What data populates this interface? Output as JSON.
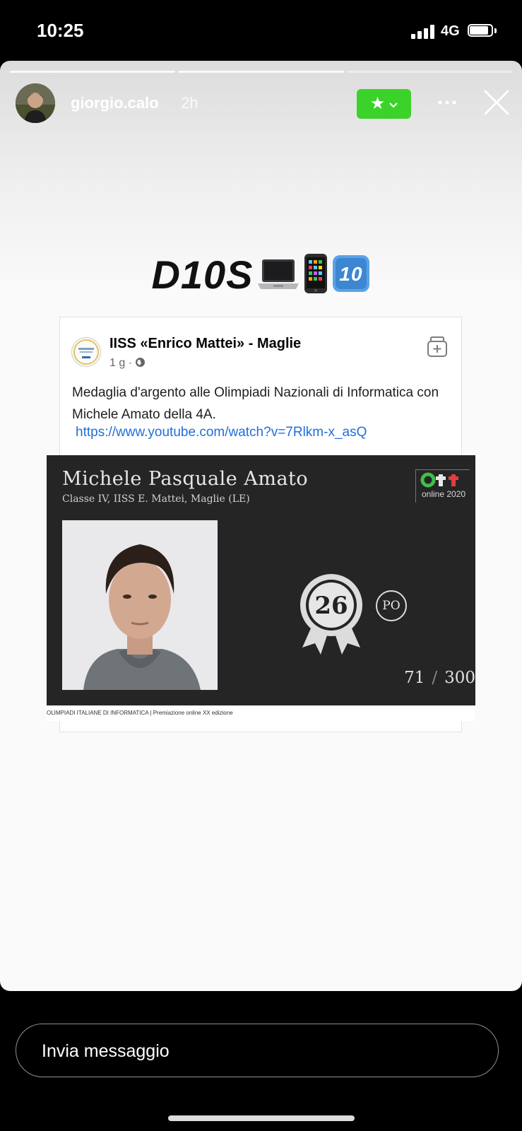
{
  "status_bar": {
    "time": "10:25",
    "network": "4G",
    "battery_level": 0.85
  },
  "story": {
    "segments": 3,
    "active_segment": 1,
    "username": "giorgio.calo",
    "time_ago": "2h",
    "close_friends_color": "#3bd32a",
    "headline": "D10S",
    "headline_emojis": [
      "laptop",
      "mobile-phone",
      "keycap-10"
    ]
  },
  "post": {
    "page_name": "IISS «Enrico Mattei» - Maglie",
    "meta": "1 g · ",
    "text": "Medaglia d'argento alle Olimpiadi Nazionali di Informatica con Michele Amato della 4A.",
    "link": "https://www.youtube.com/watch?v=7Rlkm-x_asQ"
  },
  "certificate": {
    "name": "Michele Pasquale Amato",
    "class_info": "Classe IV, IISS E. Mattei, Maglie (LE)",
    "logo_text": "online 2020",
    "rank": "26",
    "position_badge": "PO",
    "score": "71",
    "score_max": "300",
    "footer": "OLIMPIADI ITALIANE DI INFORMATICA | Premiazione online XX edizione"
  },
  "reply": {
    "placeholder": "Invia messaggio"
  }
}
